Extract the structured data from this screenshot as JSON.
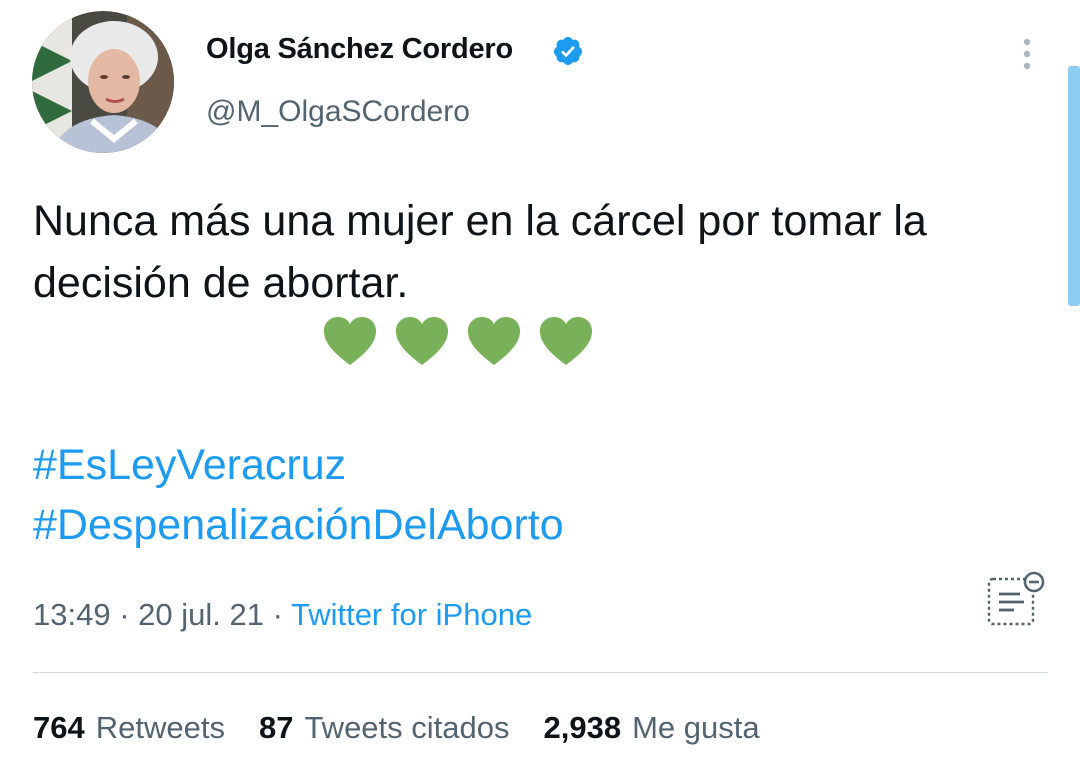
{
  "author": {
    "display_name": "Olga Sánchez Cordero",
    "handle": "@M_OlgaSCordero",
    "verified": true
  },
  "tweet": {
    "text": "Nunca más una mujer en la cárcel por tomar la decisión de abortar.",
    "emojis": [
      "green-heart",
      "green-heart",
      "green-heart",
      "green-heart"
    ],
    "hashtags": [
      "#EsLeyVeracruz",
      "#DespenalizaciónDelAborto"
    ]
  },
  "meta": {
    "time": "13:49",
    "separator": " · ",
    "date": "20 jul. 21",
    "source": "Twitter for iPhone"
  },
  "stats": {
    "retweets_count": "764",
    "retweets_label": "Retweets",
    "quotes_count": "87",
    "quotes_label": "Tweets citados",
    "likes_count": "2,938",
    "likes_label": "Me gusta"
  },
  "colors": {
    "link_blue": "#1d9bf0",
    "secondary_text": "#536471",
    "heart_green": "#78b159",
    "verified_blue": "#1d9bf0"
  }
}
